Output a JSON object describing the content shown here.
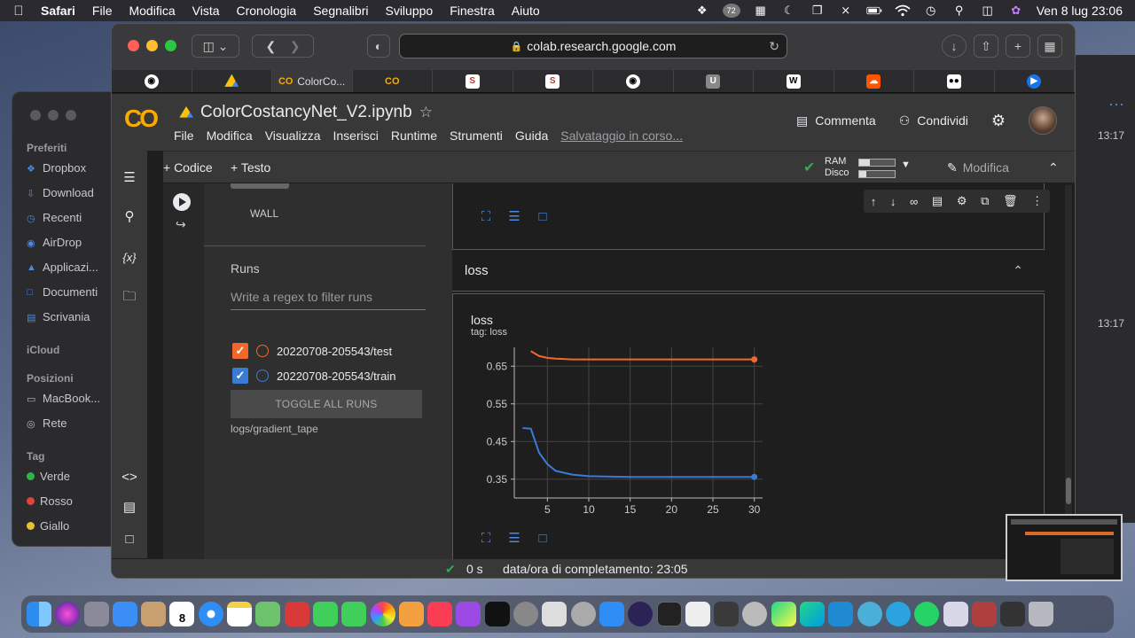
{
  "menubar": {
    "app": "Safari",
    "items": [
      "File",
      "Modifica",
      "Vista",
      "Cronologia",
      "Segnalibri",
      "Sviluppo",
      "Finestra",
      "Aiuto"
    ],
    "clock": "Ven 8 lug  23:06",
    "badge": "72"
  },
  "finder": {
    "favorites_title": "Preferiti",
    "favorites": [
      "Dropbox",
      "Download",
      "Recenti",
      "AirDrop",
      "Applicazi...",
      "Documenti",
      "Scrivania"
    ],
    "icloud_title": "iCloud",
    "locations_title": "Posizioni",
    "locations": [
      "MacBook...",
      "Rete"
    ],
    "tags_title": "Tag",
    "tags": [
      {
        "name": "Verde",
        "color": "#2fb34a"
      },
      {
        "name": "Rosso",
        "color": "#e0443a"
      },
      {
        "name": "Giallo",
        "color": "#e6c22e"
      }
    ]
  },
  "right_window": {
    "times": [
      "13:17",
      "13:17"
    ]
  },
  "safari": {
    "url": "colab.research.google.com",
    "tabs": [
      {
        "label": "",
        "icon": "github-icon"
      },
      {
        "label": "",
        "icon": "drive-icon"
      },
      {
        "label": "ColorCo...",
        "icon": "colab-icon"
      },
      {
        "label": "",
        "icon": "colab-icon"
      },
      {
        "label": "",
        "icon": "scholar-s-icon"
      },
      {
        "label": "",
        "icon": "scholar-s-icon"
      },
      {
        "label": "",
        "icon": "github-icon"
      },
      {
        "label": "",
        "icon": "u-icon"
      },
      {
        "label": "",
        "icon": "wikipedia-icon"
      },
      {
        "label": "",
        "icon": "soundcloud-icon"
      },
      {
        "label": "",
        "icon": "medium-icon"
      },
      {
        "label": "",
        "icon": "play-icon"
      }
    ]
  },
  "colab": {
    "logo": "CO",
    "title": "ColorCostancyNet_V2.ipynb",
    "menu": [
      "File",
      "Modifica",
      "Visualizza",
      "Inserisci",
      "Runtime",
      "Strumenti",
      "Guida"
    ],
    "saving": "Salvataggio in corso...",
    "comment": "Commenta",
    "share": "Condividi",
    "add_code": "+ Codice",
    "add_text": "+ Testo",
    "ram_label": "RAM",
    "disk_label": "Disco",
    "ram_usage": 0.3,
    "disk_usage": 0.2,
    "edit": "Modifica",
    "status_time": "0 s",
    "status_text": "data/ora di completamento: 23:05"
  },
  "tensorboard": {
    "wall": "WALL",
    "runs_title": "Runs",
    "filter_placeholder": "Write a regex to filter runs",
    "runs": [
      {
        "name": "20220708-205543/test",
        "color": "#f4672b",
        "checked": true
      },
      {
        "name": "20220708-205543/train",
        "color": "#3a7bd5",
        "checked": true
      }
    ],
    "toggle_all": "TOGGLE ALL RUNS",
    "logdir": "logs/gradient_tape",
    "section": "loss",
    "card_title": "loss",
    "card_tag": "tag: loss"
  },
  "chart_data": {
    "type": "line",
    "title": "loss",
    "xlim": [
      1,
      31
    ],
    "ylim": [
      0.3,
      0.7
    ],
    "xticks": [
      5,
      10,
      15,
      20,
      25,
      30
    ],
    "yticks": [
      0.35,
      0.45,
      0.55,
      0.65
    ],
    "grid": true,
    "series": [
      {
        "name": "20220708-205543/test",
        "color": "#f4672b",
        "x": [
          3,
          4,
          5,
          6,
          8,
          10,
          12,
          15,
          20,
          25,
          30
        ],
        "y": [
          0.69,
          0.677,
          0.672,
          0.67,
          0.668,
          0.668,
          0.668,
          0.668,
          0.668,
          0.668,
          0.668
        ]
      },
      {
        "name": "20220708-205543/train",
        "color": "#3a7bd5",
        "x": [
          2,
          3,
          4,
          5,
          6,
          8,
          10,
          12,
          15,
          20,
          25,
          30
        ],
        "y": [
          0.486,
          0.484,
          0.42,
          0.39,
          0.372,
          0.362,
          0.358,
          0.357,
          0.356,
          0.356,
          0.356,
          0.356
        ]
      }
    ]
  }
}
